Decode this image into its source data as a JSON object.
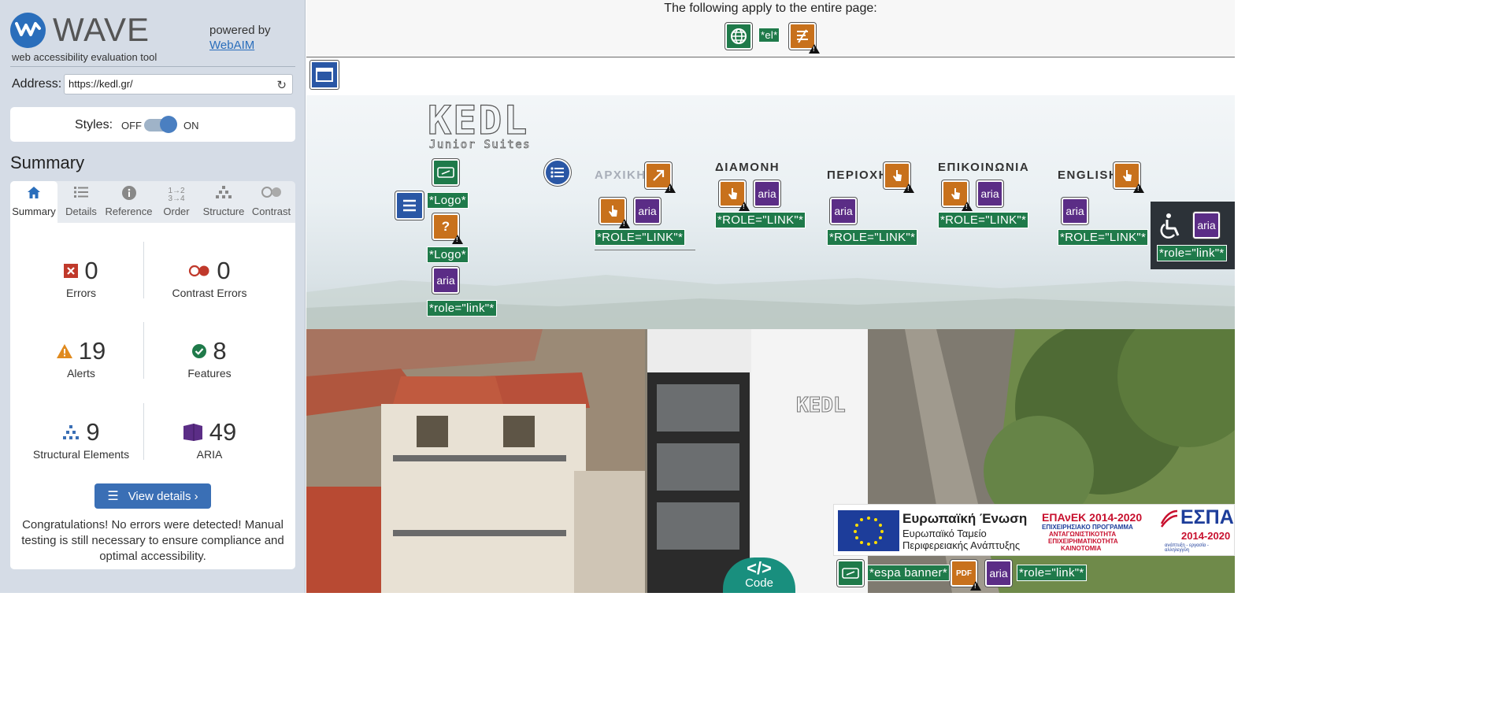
{
  "wave": {
    "logo_text": "WAVE",
    "tagline": "web accessibility evaluation tool",
    "powered_by": "powered by",
    "webaim_link": "WebAIM"
  },
  "address": {
    "label": "Address:",
    "value": "https://kedl.gr/"
  },
  "styles": {
    "label": "Styles:",
    "off": "OFF",
    "on": "ON",
    "state": "on"
  },
  "summary_title": "Summary",
  "tabs": [
    {
      "label": "Summary",
      "icon": "home-icon",
      "active": true
    },
    {
      "label": "Details",
      "icon": "list-icon"
    },
    {
      "label": "Reference",
      "icon": "info-icon"
    },
    {
      "label": "Order",
      "icon": "order-icon"
    },
    {
      "label": "Structure",
      "icon": "structure-icon"
    },
    {
      "label": "Contrast",
      "icon": "contrast-icon"
    }
  ],
  "stats": {
    "errors": {
      "value": "0",
      "label": "Errors"
    },
    "contrast_errors": {
      "value": "0",
      "label": "Contrast Errors"
    },
    "alerts": {
      "value": "19",
      "label": "Alerts"
    },
    "features": {
      "value": "8",
      "label": "Features"
    },
    "structural": {
      "value": "9",
      "label": "Structural Elements"
    },
    "aria": {
      "value": "49",
      "label": "ARIA"
    }
  },
  "view_details": "View details ›",
  "congrats": "Congratulations! No errors were detected! Manual testing is still necessary to ensure compliance and optimal accessibility.",
  "page": {
    "banner_text": "The following apply to the entire page:",
    "lang_label": "*el*",
    "logo_big": "KEDL",
    "logo_sub": "Junior Suites",
    "labels": {
      "logo1": "*Logo*",
      "logo2": "*Logo*",
      "role_link_lower": "*role=\"link\"*",
      "role_link_upper": "*ROLE=\"LINK\"*",
      "espa_banner": "*espa banner*"
    },
    "nav": [
      "ΑΡΧΙΚΗ",
      "ΔΙΑΜΟΝΗ",
      "ΠΕΡΙΟΧΗ",
      "ΕΠΙΚΟΙΝΩΝΙΑ",
      "ENGLISH"
    ],
    "aria_text": "aria",
    "code_label": "Code",
    "espa": {
      "eu_title": "Ευρωπαϊκή Ένωση",
      "eu_sub1": "Ευρωπαϊκό Ταμείο",
      "eu_sub2": "Περιφερειακής Ανάπτυξης",
      "epanek": "ΕΠΑνΕΚ 2014-2020",
      "epanek_sub1": "ΕΠΙΧΕΙΡΗΣΙΑΚΟ ΠΡΟΓΡΑΜΜΑ",
      "epanek_sub2": "ΑΝΤΑΓΩΝΙΣΤΙΚΟΤΗΤΑ",
      "epanek_sub3": "ΕΠΙΧΕΙΡΗΜΑΤΙΚΟΤΗΤΑ",
      "epanek_sub4": "ΚΑΙΝΟΤΟΜΙΑ",
      "espa": "ΕΣΠΑ",
      "espa_years": "2014-2020",
      "espa_tag": "ανάπτυξη - εργασία - αλληλεγγύη",
      "pdf": "PDF"
    }
  },
  "colors": {
    "wave_blue": "#2a6ebb",
    "feature_green": "#1f7a4a",
    "alert_orange": "#c8711c",
    "aria_purple": "#5b2d86",
    "error_red": "#c0392b",
    "code_teal": "#198f7e"
  }
}
